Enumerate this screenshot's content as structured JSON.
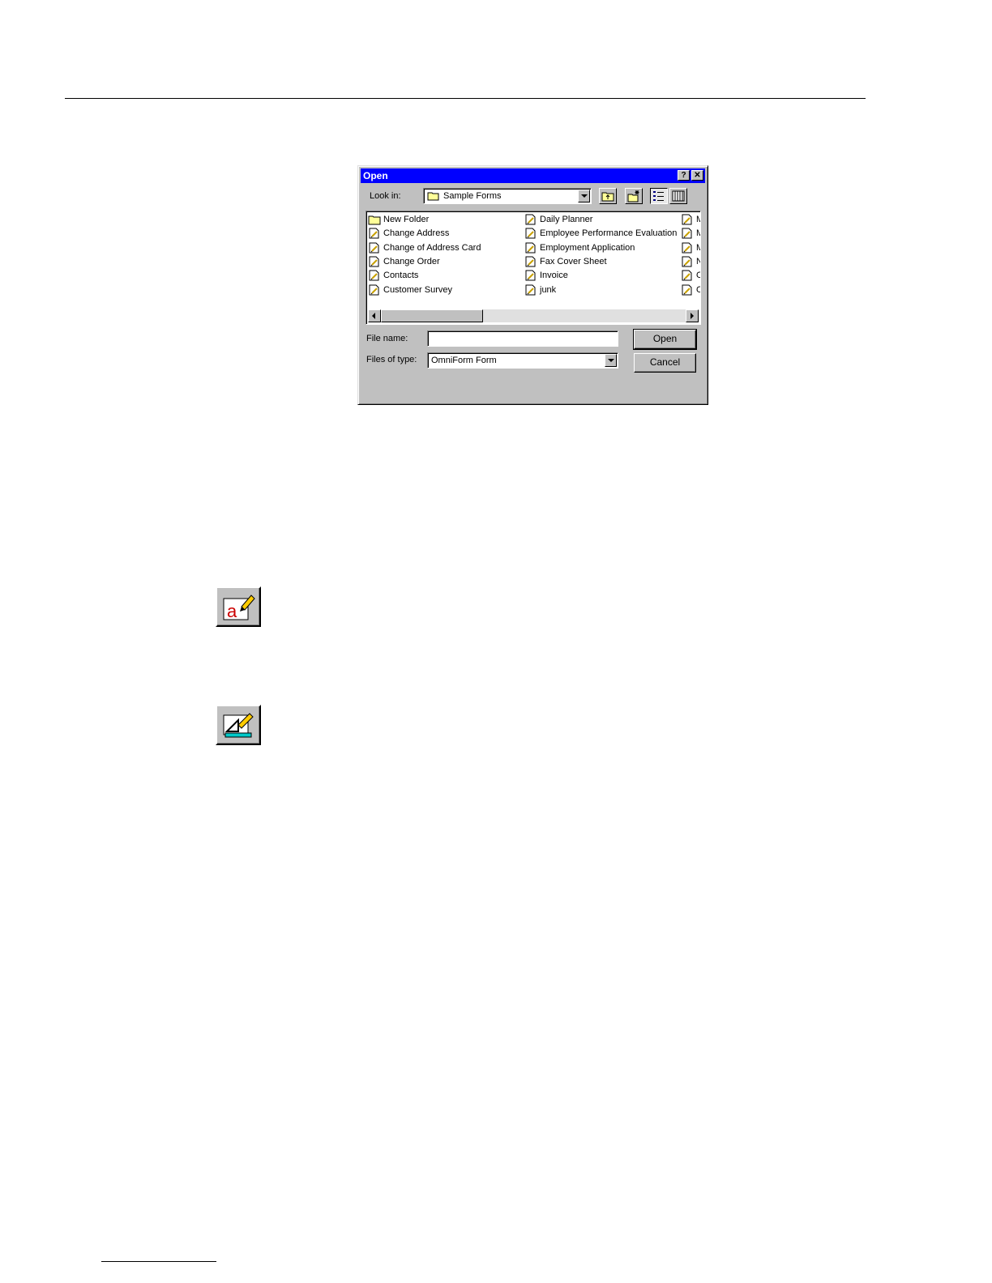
{
  "dialog": {
    "title": "Open",
    "help_button": "?",
    "close_button": "✕",
    "look_in_label": "Look in:",
    "look_in_value": "Sample Forms",
    "file_name_label": "File name:",
    "file_name_value": "",
    "files_of_type_label": "Files of type:",
    "files_of_type_value": "OmniForm Form",
    "open_button": "Open",
    "cancel_button": "Cancel",
    "files": {
      "col1": [
        "New Folder",
        "Change Address",
        "Change of Address Card",
        "Change Order",
        "Contacts",
        "Customer Survey"
      ],
      "col2": [
        "Daily Planner",
        "Employee Performance Evaluation",
        "Employment Application",
        "Fax Cover Sheet",
        "Invoice",
        "junk"
      ],
      "col3": [
        "M",
        "M",
        "M",
        "N",
        "O",
        "O"
      ]
    }
  },
  "icons": {
    "text_tool": "text-edit-icon",
    "draw_tool": "draw-form-icon"
  }
}
